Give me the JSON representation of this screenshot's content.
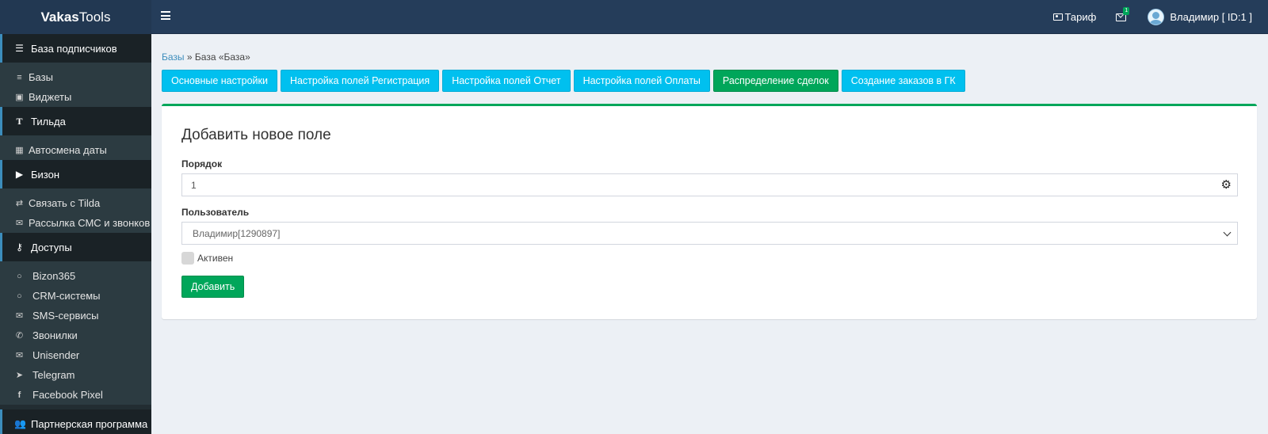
{
  "header": {
    "brand_bold": "Vakas",
    "brand_rest": "Tools",
    "tariff_label": "Тариф",
    "mail_badge": "1",
    "user_label": "Владимир [ ID:1 ]"
  },
  "sidebar": {
    "sections": [
      {
        "label": "База подписчиков",
        "icon": "database-list-icon"
      },
      {
        "label": "Тильда",
        "icon": "text-icon"
      },
      {
        "label": "Бизон",
        "icon": "youtube-icon"
      },
      {
        "label": "Доступы",
        "icon": "key-icon"
      },
      {
        "label": "Партнерская программа",
        "icon": "users-icon"
      }
    ],
    "items": [
      {
        "label": "Базы",
        "icon": "database-icon"
      },
      {
        "label": "Виджеты",
        "icon": "widget-icon"
      },
      {
        "label": "Автосмена даты",
        "icon": "calendar-icon"
      },
      {
        "label": "Связать с Tilda",
        "icon": "exchange-icon"
      },
      {
        "label": "Рассылка СМС и звонков",
        "icon": "envelope-icon"
      },
      {
        "label": "Bizon365",
        "icon": "circle-icon"
      },
      {
        "label": "CRM-системы",
        "icon": "circle-icon"
      },
      {
        "label": "SMS-сервисы",
        "icon": "envelope-icon"
      },
      {
        "label": "Звонилки",
        "icon": "phone-icon"
      },
      {
        "label": "Unisender",
        "icon": "envelope-icon"
      },
      {
        "label": "Telegram",
        "icon": "paper-plane-icon"
      },
      {
        "label": "Facebook Pixel",
        "icon": "facebook-icon"
      }
    ]
  },
  "breadcrumb": {
    "link": "Базы",
    "separator": "»",
    "current": "База «База»"
  },
  "tabs": [
    {
      "label": "Основные настройки"
    },
    {
      "label": "Настройка полей Регистрация"
    },
    {
      "label": "Настройка полей Отчет"
    },
    {
      "label": "Настройка полей Оплаты"
    },
    {
      "label": "Распределение сделок"
    },
    {
      "label": "Создание заказов в ГК"
    }
  ],
  "active_tab": "Распределение сделок",
  "form": {
    "title": "Добавить новое поле",
    "order_label": "Порядок",
    "order_value": "1",
    "user_label": "Пользователь",
    "user_value": "Владимир[1290897]",
    "active_label": "Активен",
    "submit_label": "Добавить"
  },
  "colors": {
    "header": "#253d5a",
    "sidebar": "#222d32",
    "tab": "#00c0ef",
    "active_tab": "#00a65a",
    "success": "#00a65a"
  }
}
